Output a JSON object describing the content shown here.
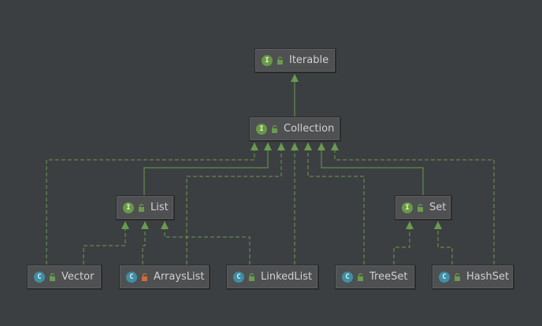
{
  "colors": {
    "background": "#3c3f41",
    "node_fill": "#4e5052",
    "edge": "#6a9b4f",
    "interface_badge": "#689a43",
    "class_badge": "#3e8fa6",
    "lock_public": "#6a9b4f",
    "lock_private": "#d06a3a"
  },
  "nodes": [
    {
      "id": "iterable",
      "label": "Iterable",
      "kind": "I",
      "visibility": "public"
    },
    {
      "id": "collection",
      "label": "Collection",
      "kind": "I",
      "visibility": "public"
    },
    {
      "id": "list",
      "label": "List",
      "kind": "I",
      "visibility": "public"
    },
    {
      "id": "set",
      "label": "Set",
      "kind": "I",
      "visibility": "public"
    },
    {
      "id": "vector",
      "label": "Vector",
      "kind": "C",
      "visibility": "public"
    },
    {
      "id": "arrayslist",
      "label": "ArraysList",
      "kind": "C",
      "visibility": "private"
    },
    {
      "id": "linkedlist",
      "label": "LinkedList",
      "kind": "C",
      "visibility": "public"
    },
    {
      "id": "treeset",
      "label": "TreeSet",
      "kind": "C",
      "visibility": "public"
    },
    {
      "id": "hashset",
      "label": "HashSet",
      "kind": "C",
      "visibility": "public"
    }
  ],
  "edges": [
    {
      "from": "collection",
      "to": "iterable",
      "style": "solid"
    },
    {
      "from": "list",
      "to": "collection",
      "style": "solid"
    },
    {
      "from": "set",
      "to": "collection",
      "style": "solid"
    },
    {
      "from": "vector",
      "to": "collection",
      "style": "dashed"
    },
    {
      "from": "arrayslist",
      "to": "collection",
      "style": "dashed"
    },
    {
      "from": "linkedlist",
      "to": "collection",
      "style": "dashed"
    },
    {
      "from": "treeset",
      "to": "collection",
      "style": "dashed"
    },
    {
      "from": "hashset",
      "to": "collection",
      "style": "dashed"
    },
    {
      "from": "vector",
      "to": "list",
      "style": "dashed"
    },
    {
      "from": "arrayslist",
      "to": "list",
      "style": "dashed"
    },
    {
      "from": "linkedlist",
      "to": "list",
      "style": "dashed"
    },
    {
      "from": "treeset",
      "to": "set",
      "style": "dashed"
    },
    {
      "from": "hashset",
      "to": "set",
      "style": "dashed"
    }
  ]
}
